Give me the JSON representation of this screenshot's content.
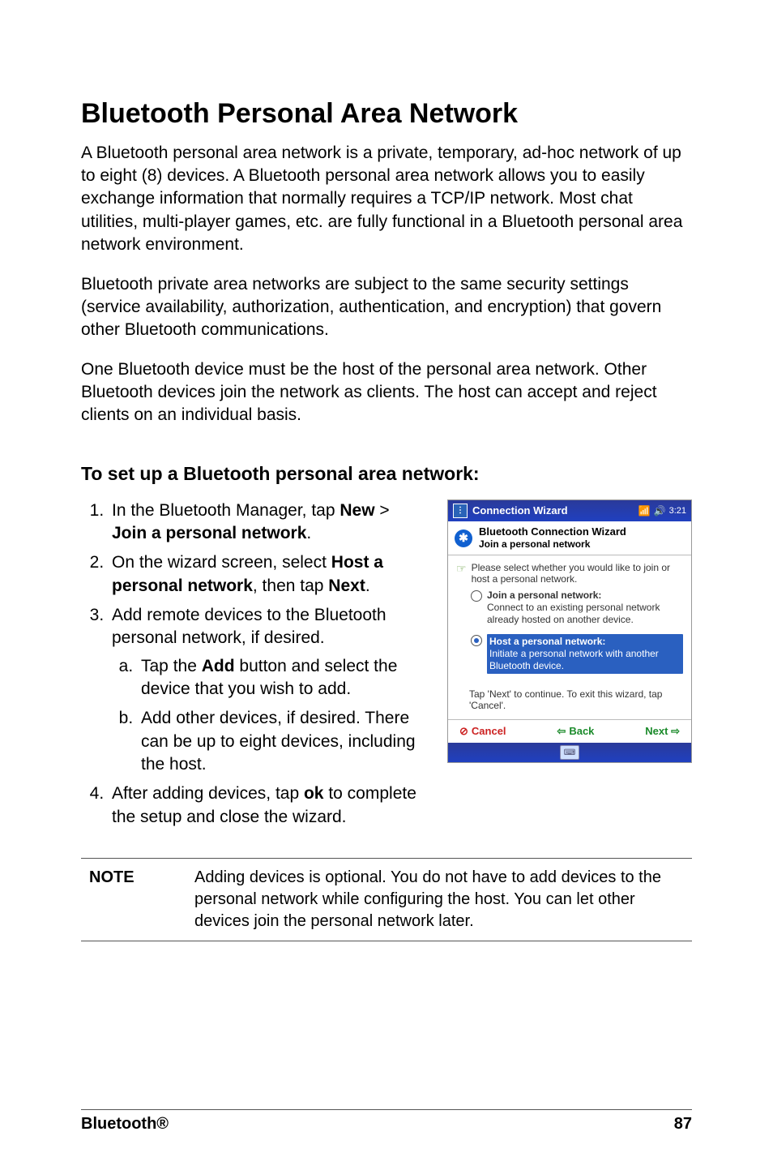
{
  "heading": "Bluetooth Personal Area Network",
  "paragraphs": {
    "p1": "A Bluetooth personal area network is a private, temporary, ad-hoc network of up to eight (8) devices. A Bluetooth personal area network allows you to easily exchange information that normally requires a TCP/IP network. Most chat utilities, multi-player games, etc. are fully functional in a Bluetooth personal area network environment.",
    "p2": "Bluetooth private area networks are subject to the same security settings (service availability, authorization, authentication, and encryption) that govern other Bluetooth communications.",
    "p3": "One Bluetooth device must be the host of the personal area network. Other Bluetooth devices join the network as clients. The host can accept and reject clients on an individual basis."
  },
  "subheading": "To set up a Bluetooth personal area network:",
  "steps": {
    "s1a": "In the Bluetooth Manager, tap ",
    "s1b": "New",
    "s1c": " > ",
    "s1d": "Join a personal network",
    "s1e": ".",
    "s2a": "On the wizard screen, select ",
    "s2b": "Host a personal network",
    "s2c": ", then tap ",
    "s2d": "Next",
    "s2e": ".",
    "s3": "Add remote devices to the Bluetooth personal network, if desired.",
    "s3aa": "Tap the ",
    "s3ab": "Add",
    "s3ac": " button and select the device that you wish to add.",
    "s3b": "Add other devices, if desired. There can be up to eight devices, including the host.",
    "s4a": "After adding devices, tap ",
    "s4b": "ok",
    "s4c": " to complete the setup and close the wizard."
  },
  "note": {
    "label": "NOTE",
    "text": "Adding devices is optional. You do not have to add devices to the personal network while configuring the host. You can let other devices join the personal network later."
  },
  "footer": {
    "left": "Bluetooth®",
    "right": "87"
  },
  "phone": {
    "title": "Connection Wizard",
    "clock": "3:21",
    "header_line1": "Bluetooth Connection Wizard",
    "header_line2": "Join a personal network",
    "prompt": "Please select whether you would like to join or host a personal network.",
    "option1_title": "Join a personal network:",
    "option1_desc": "Connect to an existing personal network already hosted on another device.",
    "option2_title": "Host a personal network:",
    "option2_desc": "Initiate a personal network with another Bluetooth device.",
    "footnote": "Tap 'Next' to continue. To exit this wizard, tap 'Cancel'.",
    "cancel": "Cancel",
    "back": "Back",
    "next": "Next"
  }
}
